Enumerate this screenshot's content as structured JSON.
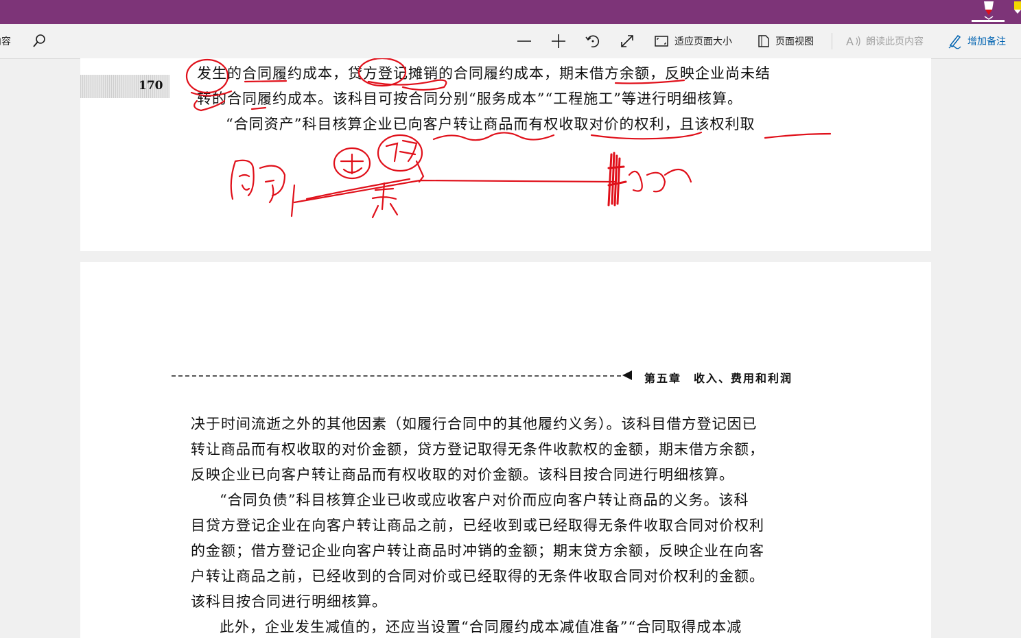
{
  "colors": {
    "title_bar": "#7d3478",
    "toolbar_bg": "#f2f2f2",
    "accent": "#0063b1",
    "ink": "#e0101a"
  },
  "toolbar": {
    "left_cutoff_label": "内容",
    "search_icon": "search-icon",
    "zoom_out_icon": "minus-icon",
    "zoom_in_icon": "plus-icon",
    "rotate_icon": "rotate-icon",
    "fullscreen_icon": "expand-icon",
    "fit_page_label": "适应页面大小",
    "page_view_label": "页面视图",
    "read_aloud_label": "朗读此页内容",
    "add_notes_label": "增加备注"
  },
  "page_top": {
    "page_number": "170",
    "lines": [
      "发生的合同履约成本，贷方登记摊销的合同履约成本，期末借方余额，反映企业尚未结",
      "转的合同履约成本。该科目可按合同分别“服务成本”“工程施工”等进行明细核算。",
      "　“合同资产”科目核算企业已向客户转让商品而有权收取对价的权利，且该权利取"
    ]
  },
  "page_bottom": {
    "chapter_header": "第五章　收入、费用和利润",
    "lines": [
      "决于时间流逝之外的其他因素（如履行合同中的其他履约义务）。该科目借方登记因已",
      "转让商品而有权收取的对价金额，贷方登记取得无条件收款权的金额，期末借方余额，",
      "反映企业已向客户转让商品而有权收取的对价金额。该科目按合同进行明细核算。",
      "　“合同负债”科目核算企业已收或应收客户对价而应向客户转让商品的义务。该科",
      "目贷方登记企业在向客户转让商品之前，已经收到或已经取得无条件收取合同对价权利",
      "的金额；借方登记企业向客户转让商品时冲销的金额；期末贷方余额，反映企业在向客",
      "户转让商品之前，已经收到的合同对价或已经取得的无条件收取合同对价权利的金额。",
      "该科目按合同进行明细核算。",
      "　此外，企业发生减值的，还应当设置“合同履约成本减值准备”“合同取得成本减"
    ]
  }
}
